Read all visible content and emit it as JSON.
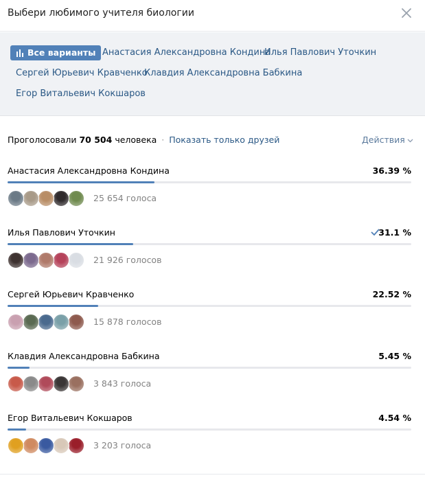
{
  "header": {
    "title": "Выбери любимого учителя биологии"
  },
  "filters": [
    {
      "label": "Все варианты",
      "active": true
    },
    {
      "label": "Анастасия Александровна Кондина",
      "active": false
    },
    {
      "label": "Илья Павлович Уточкин",
      "active": false
    },
    {
      "label": "Сергей Юрьевич Кравченко",
      "active": false
    },
    {
      "label": "Клавдия Александровна Бабкина",
      "active": false
    },
    {
      "label": "Егор Витальевич Кокшаров",
      "active": false
    }
  ],
  "summary": {
    "prefix": "Проголосовали",
    "count": "70 504",
    "suffix": "человека",
    "separator": "·",
    "friends_link": "Показать только друзей",
    "actions_label": "Действия"
  },
  "options": [
    {
      "name": "Анастасия Александровна Кондина",
      "percent": "36.39 %",
      "fraction": 0.3639,
      "votes": "25 654 голоса",
      "selected": false,
      "avatar_colors": [
        "#6b7a86",
        "#a89a88",
        "#b88d66",
        "#2f2a2c",
        "#6f8a4e"
      ]
    },
    {
      "name": "Илья Павлович Уточкин",
      "percent": "31.1 %",
      "fraction": 0.311,
      "votes": "21 926 голосов",
      "selected": true,
      "avatar_colors": [
        "#3e3230",
        "#7c6a8e",
        "#b07a6a",
        "#b5425a",
        "#d9dde3"
      ]
    },
    {
      "name": "Сергей Юрьевич Кравченко",
      "percent": "22.52 %",
      "fraction": 0.2252,
      "votes": "15 878 голосов",
      "selected": false,
      "avatar_colors": [
        "#c9a0b0",
        "#5a6a52",
        "#4a6a8e",
        "#7aa0a8",
        "#8e5a4e"
      ]
    },
    {
      "name": "Клавдия Александровна Бабкина",
      "percent": "5.45 %",
      "fraction": 0.0545,
      "votes": "3 843 голоса",
      "selected": false,
      "avatar_colors": [
        "#c85a4a",
        "#8a8a8a",
        "#b04a5a",
        "#3a3636",
        "#9a7060"
      ]
    },
    {
      "name": "Егор Витальевич Кокшаров",
      "percent": "4.54 %",
      "fraction": 0.0454,
      "votes": "3 203 голоса",
      "selected": false,
      "avatar_colors": [
        "#e0a020",
        "#d08a60",
        "#3a5aa0",
        "#d8c8b8",
        "#9a1e2a"
      ]
    }
  ],
  "colors": {
    "accent": "#5181b8",
    "link": "#2a5885",
    "bar_track": "#e7e8ec",
    "filters_bg": "#f0f2f5"
  },
  "icons": {
    "close": "close-icon",
    "all_variants": "bar-chart-icon",
    "actions": "chevron-down-icon",
    "selected": "checkmark-icon"
  }
}
